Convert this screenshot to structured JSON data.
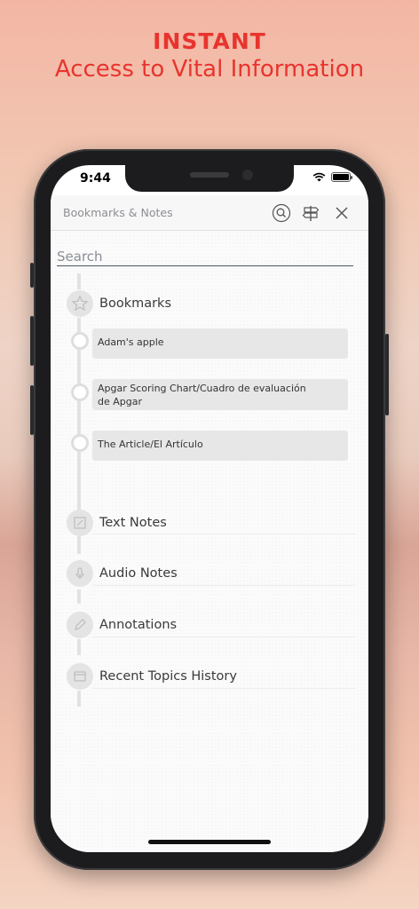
{
  "promo": {
    "headline": "INSTANT",
    "subheadline": "Access to Vital Information"
  },
  "status_bar": {
    "time": "9:44"
  },
  "navbar": {
    "title": "Bookmarks & Notes",
    "icons": [
      "search-icon",
      "signpost-icon",
      "close-icon"
    ]
  },
  "search": {
    "placeholder": "Search"
  },
  "sections": [
    {
      "label": "Bookmarks",
      "icon": "star-icon"
    },
    {
      "label": "Text Notes",
      "icon": "text-note-icon"
    },
    {
      "label": "Audio Notes",
      "icon": "microphone-icon"
    },
    {
      "label": "Annotations",
      "icon": "pencil-icon"
    },
    {
      "label": "Recent Topics History",
      "icon": "history-icon"
    }
  ],
  "bookmarks": [
    {
      "title": "Adam's apple"
    },
    {
      "title": "Apgar Scoring Chart/Cuadro de evaluación de Apgar"
    },
    {
      "title": "The Article/El Artículo"
    }
  ],
  "colors": {
    "accent": "#e8342e",
    "timeline": "#e2e2e2",
    "item_bg": "#e7e7e7"
  }
}
